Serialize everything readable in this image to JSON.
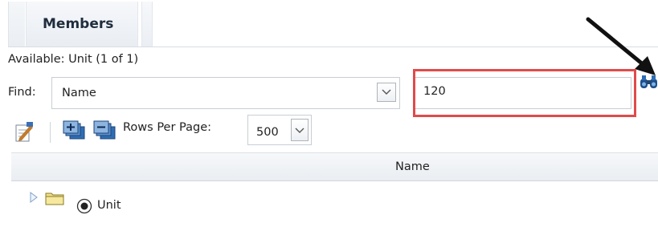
{
  "tabs": [
    {
      "label": "Members",
      "active": true
    }
  ],
  "available_text": "Available:  Unit (1 of 1)",
  "find": {
    "label": "Find:",
    "field_selected": "Name",
    "search_value": "120"
  },
  "toolbar": {
    "rows_per_page_label": "Rows Per Page:",
    "rows_per_page_value": "500"
  },
  "table": {
    "columns": [
      "Name"
    ],
    "rows": [
      {
        "label": "Unit",
        "type": "folder",
        "selected": true,
        "expanded": false
      }
    ]
  },
  "annotation": {
    "color": "#e04b4b"
  },
  "icons": [
    "binoculars-icon",
    "properties-icon",
    "expand-all-icon",
    "collapse-all-icon",
    "tree-expand-icon",
    "folder-icon",
    "radio-icon",
    "chevron-down-icon"
  ]
}
